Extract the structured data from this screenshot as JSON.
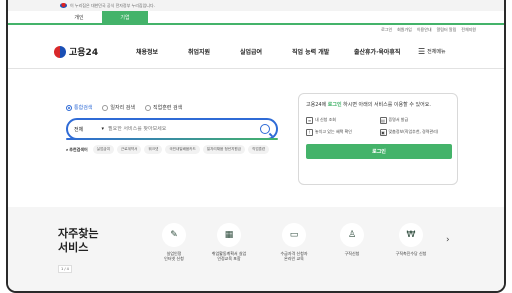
{
  "gov_bar": {
    "text": "이 누리집은 대한민국 공식 전자정부 누리집입니다."
  },
  "tabs": [
    {
      "label": "개인"
    },
    {
      "label": "기업"
    }
  ],
  "util_links": [
    "로그인",
    "회원가입",
    "이용안내",
    "알림터 알림",
    "전체지원"
  ],
  "logo": {
    "text": "고용24"
  },
  "menu": [
    "채용정보",
    "취업지원",
    "실업급여",
    "직업 능력 개발",
    "출산휴가·육아휴직"
  ],
  "all_menu": {
    "label": "전체메뉴"
  },
  "search_scope": [
    {
      "label": "통합검색",
      "selected": true
    },
    {
      "label": "일자리 검색",
      "selected": false
    },
    {
      "label": "직업훈련 검색",
      "selected": false
    }
  ],
  "search": {
    "category": "전체",
    "placeholder": "필요한 서비스를 찾아보세요"
  },
  "recommend": {
    "label": "추천검색어",
    "chips": [
      "실업급여",
      "근로계약서",
      "워크넷",
      "국민내일배움카드",
      "일자리채움 청년지원금",
      "직업훈련"
    ]
  },
  "login_box": {
    "msg_prefix": "고용24에 ",
    "msg_highlight": "로그인",
    "msg_suffix": " 하시면 아래의 서비스를 이용할 수 있어요.",
    "items": [
      "내 신청 조회",
      "증명서 발급",
      "놓치고 있는 혜택 확인",
      "맞춤정보(직업추천, 경력관리)"
    ],
    "button": "로그인"
  },
  "faq": {
    "title": "자주찾는\n서비스",
    "pager": "1 / 4",
    "services": [
      {
        "label": "실업인정\n인터넷 신청",
        "icon": "document-icon"
      },
      {
        "label": "취업활동계획서 실업\n인정교육 포함",
        "icon": "board-icon"
      },
      {
        "label": "수급자격 신청자\n온라인 교육",
        "icon": "monitor-icon"
      },
      {
        "label": "구직신청",
        "icon": "person-icon"
      },
      {
        "label": "구직촉진수당 신청",
        "icon": "money-icon"
      }
    ]
  },
  "colors": {
    "accent_green": "#44b36a",
    "accent_blue": "#2f6bd6"
  }
}
